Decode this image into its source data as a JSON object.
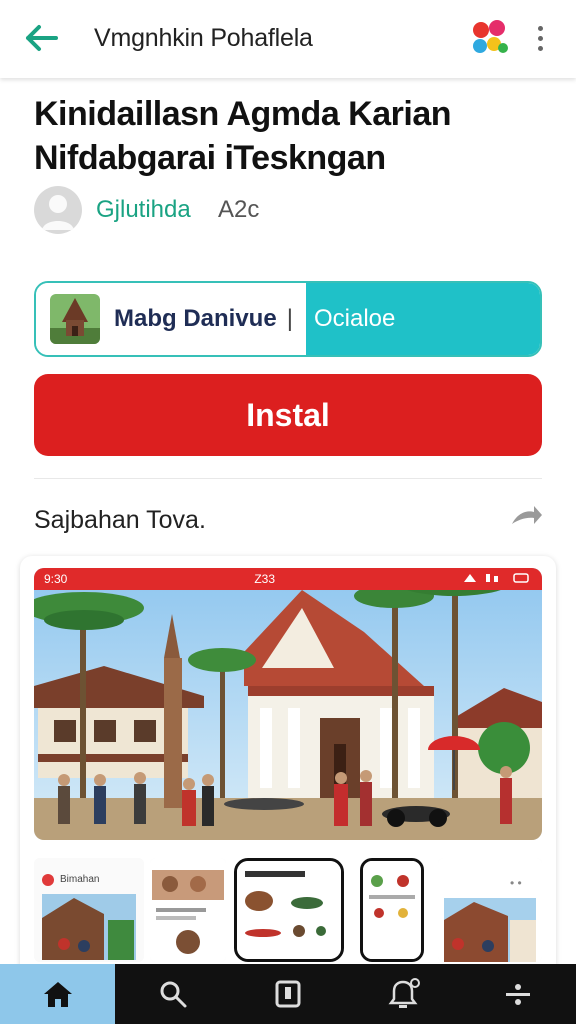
{
  "topbar": {
    "back_icon": "arrow-left-icon",
    "title": "Vmgnhkin Pohaflela",
    "logo_icon": "app-logo-icon",
    "more_icon": "more-vert-icon",
    "accent": "#1aa383"
  },
  "article": {
    "headline_line1": "Kinidaillasn Agmda Karian",
    "headline_line2": "Nifdabgarai iTeskngan",
    "author": "Gjlutihda",
    "author_extra": "A2c"
  },
  "banner": {
    "title": "Mabg Danivue",
    "separator": "|",
    "tag": "Ocialoe",
    "border_color": "#36c0b8",
    "tag_color": "#1fc1c8"
  },
  "install": {
    "label": "Instal",
    "color": "#dc1f1f"
  },
  "screenshots": {
    "title": "Sajbahan Tova.",
    "share_icon": "share-icon",
    "status_time": "9:30",
    "status_center": "Z33",
    "thumb1_label": "Bimahan"
  },
  "bottom_nav": {
    "items": [
      {
        "icon": "home-icon",
        "active": true
      },
      {
        "icon": "search-icon",
        "active": false
      },
      {
        "icon": "library-icon",
        "active": false
      },
      {
        "icon": "notifications-icon",
        "active": false
      },
      {
        "icon": "settings-icon",
        "active": false
      }
    ],
    "active_color": "#8ec7ea"
  }
}
